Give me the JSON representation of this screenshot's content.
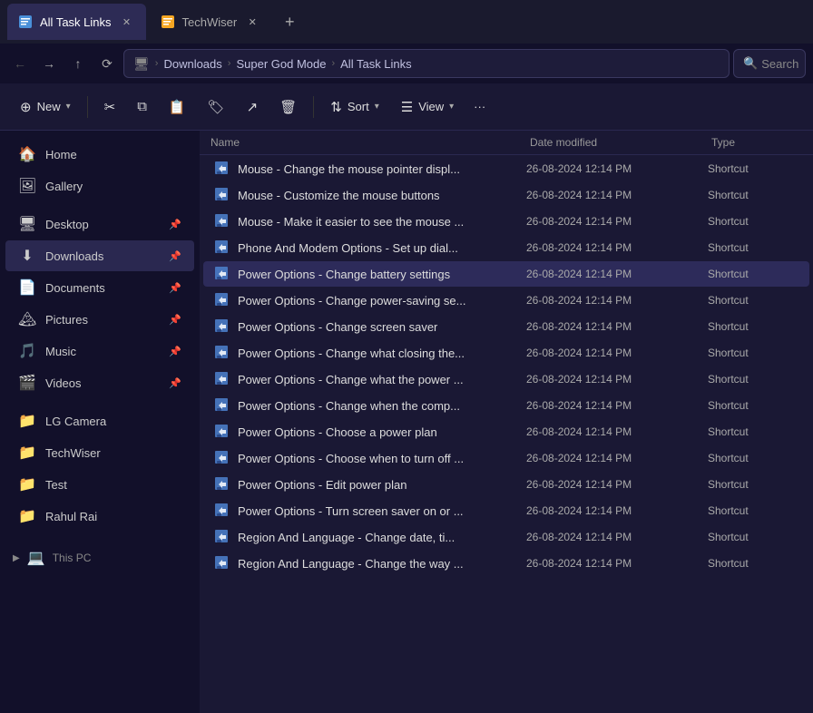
{
  "titleBar": {
    "tabs": [
      {
        "id": "tab1",
        "label": "All Task Links",
        "active": true,
        "iconColor": "#4a90d9"
      },
      {
        "id": "tab2",
        "label": "TechWiser",
        "active": false,
        "iconColor": "#f5a623"
      }
    ],
    "newTabLabel": "+"
  },
  "addressBar": {
    "back": "←",
    "forward": "→",
    "up": "↑",
    "refresh": "⟳",
    "breadcrumbs": [
      {
        "label": "Downloads"
      },
      {
        "label": "Super God Mode"
      },
      {
        "label": "All Task Links"
      }
    ],
    "searchPlaceholder": "Search"
  },
  "toolbar": {
    "newLabel": "New",
    "newChevron": "∨",
    "cutLabel": "",
    "copyLabel": "",
    "pasteLabel": "",
    "renameLabel": "",
    "shareLabel": "",
    "deleteLabel": "",
    "sortLabel": "Sort",
    "sortChevron": "∨",
    "viewLabel": "View",
    "viewChevron": "∨",
    "moreLabel": "···"
  },
  "sidebar": {
    "items": [
      {
        "id": "home",
        "label": "Home",
        "icon": "🏠",
        "pinned": false
      },
      {
        "id": "gallery",
        "label": "Gallery",
        "icon": "🖼",
        "pinned": false
      },
      {
        "id": "desktop",
        "label": "Desktop",
        "icon": "🖥",
        "pinned": true
      },
      {
        "id": "downloads",
        "label": "Downloads",
        "icon": "⬇",
        "pinned": true,
        "active": true
      },
      {
        "id": "documents",
        "label": "Documents",
        "icon": "📄",
        "pinned": true
      },
      {
        "id": "pictures",
        "label": "Pictures",
        "icon": "🏔",
        "pinned": true
      },
      {
        "id": "music",
        "label": "Music",
        "icon": "🎵",
        "pinned": true
      },
      {
        "id": "videos",
        "label": "Videos",
        "icon": "🎬",
        "pinned": true
      },
      {
        "id": "lgcamera",
        "label": "LG Camera",
        "icon": "📁",
        "pinned": false
      },
      {
        "id": "techwiser",
        "label": "TechWiser",
        "icon": "📁",
        "pinned": false
      },
      {
        "id": "test",
        "label": "Test",
        "icon": "📁",
        "pinned": false
      },
      {
        "id": "rahulrai",
        "label": "Rahul Rai",
        "icon": "📁",
        "pinned": false
      }
    ],
    "thisPC": "This PC",
    "thisPCIcon": "💻"
  },
  "fileList": {
    "columns": {
      "name": "Name",
      "dateModified": "Date modified",
      "type": "Type"
    },
    "files": [
      {
        "name": "Mouse - Change the mouse pointer displ...",
        "date": "26-08-2024 12:14 PM",
        "type": "Shortcut",
        "selected": false
      },
      {
        "name": "Mouse - Customize the mouse buttons",
        "date": "26-08-2024 12:14 PM",
        "type": "Shortcut",
        "selected": false
      },
      {
        "name": "Mouse - Make it easier to see the mouse ...",
        "date": "26-08-2024 12:14 PM",
        "type": "Shortcut",
        "selected": false
      },
      {
        "name": "Phone And Modem Options - Set up dial...",
        "date": "26-08-2024 12:14 PM",
        "type": "Shortcut",
        "selected": false
      },
      {
        "name": "Power Options - Change battery settings",
        "date": "26-08-2024 12:14 PM",
        "type": "Shortcut",
        "selected": true
      },
      {
        "name": "Power Options - Change power-saving se...",
        "date": "26-08-2024 12:14 PM",
        "type": "Shortcut",
        "selected": false
      },
      {
        "name": "Power Options - Change screen saver",
        "date": "26-08-2024 12:14 PM",
        "type": "Shortcut",
        "selected": false
      },
      {
        "name": "Power Options - Change what closing the...",
        "date": "26-08-2024 12:14 PM",
        "type": "Shortcut",
        "selected": false
      },
      {
        "name": "Power Options - Change what the power ...",
        "date": "26-08-2024 12:14 PM",
        "type": "Shortcut",
        "selected": false
      },
      {
        "name": "Power Options - Change when the comp...",
        "date": "26-08-2024 12:14 PM",
        "type": "Shortcut",
        "selected": false
      },
      {
        "name": "Power Options - Choose a power plan",
        "date": "26-08-2024 12:14 PM",
        "type": "Shortcut",
        "selected": false
      },
      {
        "name": "Power Options - Choose when to turn off ...",
        "date": "26-08-2024 12:14 PM",
        "type": "Shortcut",
        "selected": false
      },
      {
        "name": "Power Options - Edit power plan",
        "date": "26-08-2024 12:14 PM",
        "type": "Shortcut",
        "selected": false
      },
      {
        "name": "Power Options - Turn screen saver on or ...",
        "date": "26-08-2024 12:14 PM",
        "type": "Shortcut",
        "selected": false
      },
      {
        "name": "Region And Language - Change date, ti...",
        "date": "26-08-2024 12:14 PM",
        "type": "Shortcut",
        "selected": false
      },
      {
        "name": "Region And Language - Change the way ...",
        "date": "26-08-2024 12:14 PM",
        "type": "Shortcut",
        "selected": false
      }
    ]
  }
}
